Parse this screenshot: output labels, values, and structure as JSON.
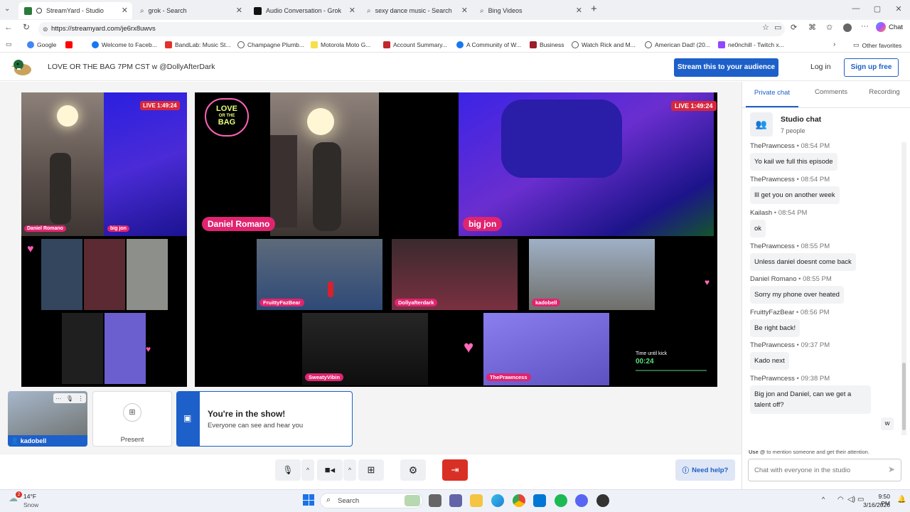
{
  "browser": {
    "tabs": [
      {
        "label": "StreamYard - Studio",
        "active": true,
        "color": "#2a7a3a"
      },
      {
        "label": "grok - Search",
        "active": false,
        "color": "#3b82f6"
      },
      {
        "label": "Audio Conversation - Grok",
        "active": false,
        "color": "#111111"
      },
      {
        "label": "sexy dance music - Search",
        "active": false,
        "color": "#3b82f6"
      },
      {
        "label": "Bing Videos",
        "active": false,
        "color": "#3b82f6"
      }
    ],
    "url": "https://streamyard.com/je6rx8uwvs",
    "chat_label": "Chat",
    "favorites": [
      {
        "label": "Google",
        "color": "#4285f4"
      },
      {
        "label": "",
        "color": "#ff0000"
      },
      {
        "label": "Welcome to Faceb...",
        "color": "#1877f2"
      },
      {
        "label": "BandLab: Music St...",
        "color": "#e3322b"
      },
      {
        "label": "Champagne Plumb...",
        "color": "#555555"
      },
      {
        "label": "Motorola Moto G...",
        "color": "#f5e04a"
      },
      {
        "label": "Account Summary...",
        "color": "#c1272d"
      },
      {
        "label": "A Community of W...",
        "color": "#1877f2"
      },
      {
        "label": "Business",
        "color": "#9b1c2c"
      },
      {
        "label": "Watch Rick and M...",
        "color": "#555555"
      },
      {
        "label": "American Dad! (20...",
        "color": "#555555"
      },
      {
        "label": "ne0nchill - Twitch x...",
        "color": "#9146ff"
      }
    ],
    "other_favorites": "Other favorites"
  },
  "header": {
    "title": "LOVE OR THE BAG 7PM CST w @DollyAfterDark",
    "stream_button": "Stream this to your audience",
    "login": "Log in",
    "signup": "Sign up free"
  },
  "stage": {
    "live_label": "LIVE 1:49:24",
    "show_logo_text": [
      "LOVE",
      "OR THE",
      "BAG"
    ],
    "main_names": [
      "Daniel Romano",
      "big jon"
    ],
    "guest_names": [
      "FruittyFazBear",
      "Dollyafterdark",
      "kadobell",
      "SweatyVibin",
      "ThePrawncess"
    ],
    "timer_label": "Time until kick",
    "timer_value": "00:24"
  },
  "bottom": {
    "self_name": "kadobell",
    "present_label": "Present",
    "notice_title": "You're in the show!",
    "notice_sub": "Everyone can see and hear you",
    "help_label": "Need help?"
  },
  "sidebar": {
    "tabs": [
      "Private chat",
      "Comments",
      "Recording"
    ],
    "chat_title": "Studio chat",
    "chat_people": "7 people",
    "messages": [
      {
        "name": "ThePrawncess",
        "time": "08:54 PM",
        "text": "Yo kail we full this episode"
      },
      {
        "name": "ThePrawncess",
        "time": "08:54 PM",
        "text": "Ill get you on another week"
      },
      {
        "name": "Kailash",
        "time": "08:54 PM",
        "text": "ok"
      },
      {
        "name": "ThePrawncess",
        "time": "08:55 PM",
        "text": "Unless daniel doesnt come back"
      },
      {
        "name": "Daniel Romano",
        "time": "08:55 PM",
        "text": "Sorry my phone over heated"
      },
      {
        "name": "FruittyFazBear",
        "time": "08:56 PM",
        "text": "Be right back!"
      },
      {
        "name": "ThePrawncess",
        "time": "09:37 PM",
        "text": "Kado next"
      },
      {
        "name": "ThePrawncess",
        "time": "09:38 PM",
        "text": "Big jon and Daniel, can we get a talent off?"
      }
    ],
    "self_message": "w",
    "hint_bold": "Use @",
    "hint_rest": "to mention someone and get their attention.",
    "input_placeholder": "Chat with everyone in the studio"
  },
  "taskbar": {
    "weather_temp": "14°F",
    "weather_desc": "Snow",
    "weather_badge": "2",
    "search_label": "Search",
    "time": "9:50 PM",
    "date": "3/16/2026"
  }
}
